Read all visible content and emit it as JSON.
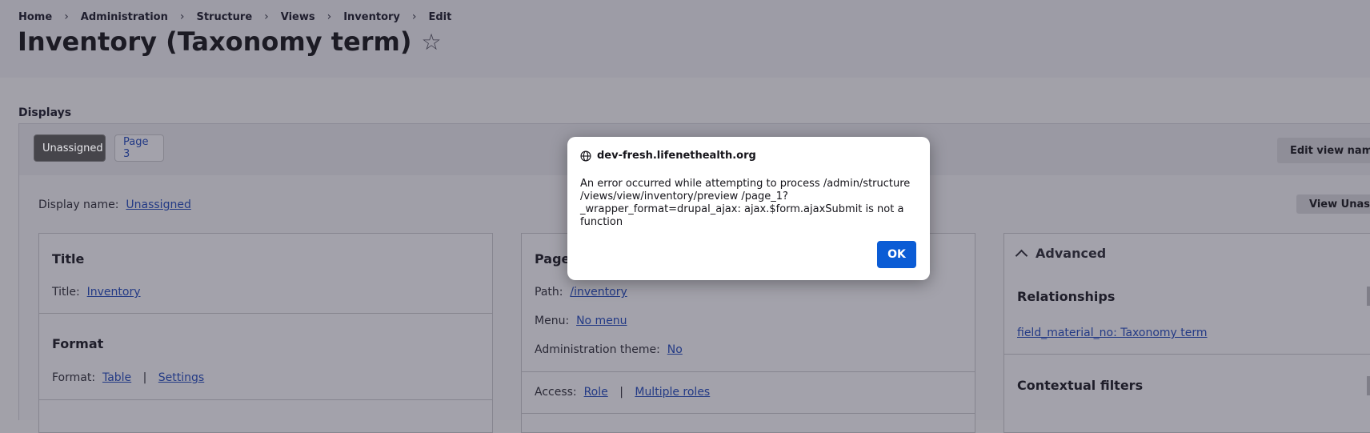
{
  "breadcrumb": [
    "Home",
    "Administration",
    "Structure",
    "Views",
    "Inventory",
    "Edit"
  ],
  "page_title": "Inventory (Taxonomy term)",
  "displays": {
    "label": "Displays",
    "tabs": [
      "Unassigned",
      "Page 3"
    ],
    "edit_view_button": "Edit view name/d",
    "display_name_label": "Display name:",
    "display_name_value": "Unassigned",
    "view_button": "View Unassig"
  },
  "col1": {
    "title_section": "Title",
    "title_label": "Title:",
    "title_value": "Inventory",
    "format_section": "Format",
    "format_label": "Format:",
    "format_value": "Table",
    "format_settings": "Settings"
  },
  "col2": {
    "section": "Page",
    "path_label": "Path:",
    "path_value": "/inventory",
    "menu_label": "Menu:",
    "menu_value": "No menu",
    "admin_theme_label": "Administration theme:",
    "admin_theme_value": "No",
    "access_label": "Access:",
    "access_value": "Role",
    "access_roles": "Multiple roles"
  },
  "col3": {
    "advanced": "Advanced",
    "relationships": "Relationships",
    "relationship_item": "field_material_no: Taxonomy term",
    "contextual_filters": "Contextual filters"
  },
  "dialog": {
    "origin": "dev-fresh.lifenethealth.org",
    "message": "An error occurred while attempting to process /admin/structure /views/view/inventory/preview /page_1?_wrapper_format=drupal_ajax: ajax.$form.ajaxSubmit is not a function",
    "ok_label": "OK"
  },
  "colors": {
    "primary_button": "#0b5cd5",
    "link": "#233a85"
  }
}
